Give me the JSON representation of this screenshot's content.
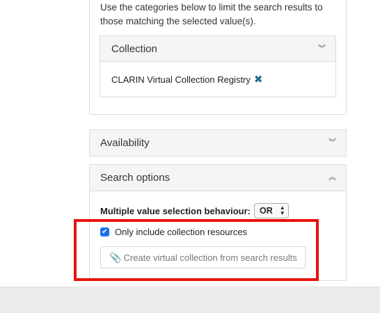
{
  "collection_panel": {
    "intro": "Use the categories below to limit the search results to those matching the selected value(s).",
    "facet_title": "Collection",
    "selected_value": "CLARIN Virtual Collection Registry"
  },
  "availability": {
    "title": "Availability"
  },
  "search_options": {
    "title": "Search options",
    "multi_value_label": "Multiple value selection behaviour:",
    "multi_value_selected": "OR",
    "checkbox_label": "Only include collection resources",
    "checkbox_checked": true,
    "create_button_label": "Create virtual collection from search results"
  },
  "colors": {
    "highlight": "#e8120c",
    "accent": "#1f6f8b",
    "checkbox": "#1a73e8"
  },
  "icons": [
    "chevron-down-double-icon",
    "chevron-up-double-icon",
    "remove-x-icon",
    "paperclip-icon",
    "select-arrows-icon"
  ]
}
